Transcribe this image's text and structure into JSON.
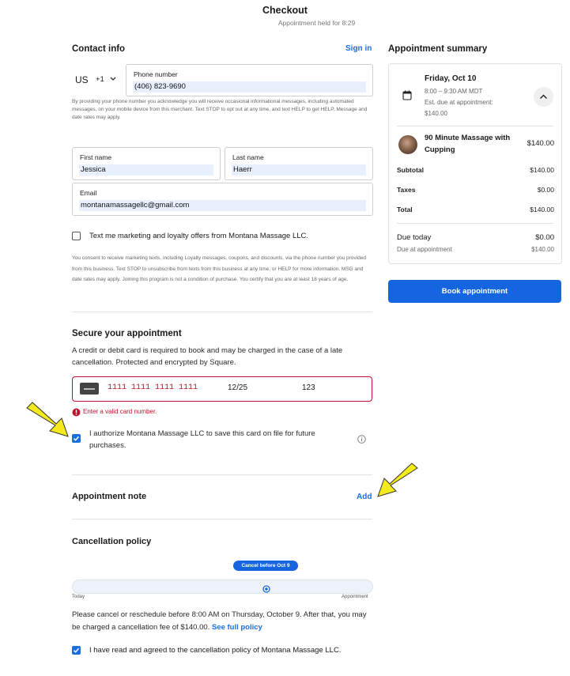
{
  "header": {
    "title": "Checkout",
    "subtitle": "Appointment held for 8:29"
  },
  "contact": {
    "heading": "Contact info",
    "sign_in": "Sign in",
    "country": "US",
    "dial_code": "+1",
    "phone_label": "Phone number",
    "phone_value": "(406) 823-9690",
    "phone_disclaimer": "By providing your phone number you acknowledge you will receive occasional informational messages, including automated messages, on your mobile device from this merchant. Text STOP to opt out at any time, and text HELP to get HELP. Message and date rates may apply.",
    "first_name_label": "First name",
    "first_name_value": "Jessica",
    "last_name_label": "Last name",
    "last_name_value": "Haerr",
    "email_label": "Email",
    "email_value": "montanamassagellc@gmail.com",
    "marketing_label": "Text me marketing and loyalty offers from Montana Massage LLC.",
    "marketing_disclaimer": "You consent to receive marketing texts, including Loyalty messages, coupons, and discounts, via the phone number you provided from this business. Text STOP to unsubscribe from texts from this business at any time, or HELP for more information. MSG and date rates may apply. Joining this program is not a condition of purchase. You certify that you are at least 18 years of age."
  },
  "secure": {
    "heading": "Secure your appointment",
    "description": "A credit or debit card is required to book and may be charged in the case of a late cancellation. Protected and encrypted by Square.",
    "card_number": "1111 1111 1111 1111",
    "expiry": "12/25",
    "cvv": "123",
    "error": "Enter a valid card number.",
    "authorize_label": "I authorize Montana Massage LLC to save this card on file for future purchases."
  },
  "note": {
    "heading": "Appointment note",
    "add": "Add"
  },
  "cancellation": {
    "heading": "Cancellation policy",
    "pill": "Cancel before Oct 9",
    "today_label": "Today",
    "appointment_label": "Appointment",
    "text": "Please cancel or reschedule before 8:00 AM on Thursday, October 9. After that, you may be charged a cancellation fee of $140.00.",
    "full_policy_link": "See full policy",
    "agree_label": "I have read and agreed to the cancellation policy of Montana Massage LLC."
  },
  "summary": {
    "heading": "Appointment summary",
    "date": "Friday, Oct 10",
    "time": "8:00 – 9:30 AM MDT",
    "est_due": "Est. due at appointment:",
    "est_amount": "$140.00",
    "service_name_line1": "90 Minute Massage with",
    "service_name_line2": "Cupping",
    "service_price": "$140.00",
    "subtotal_label": "Subtotal",
    "subtotal": "$140.00",
    "taxes_label": "Taxes",
    "taxes": "$0.00",
    "total_label": "Total",
    "total": "$140.00",
    "due_today_label": "Due today",
    "due_today": "$0.00",
    "due_appt_label": "Due at appointment",
    "due_appt": "$140.00",
    "book_button": "Book appointment"
  },
  "icons": [
    "calendar-icon",
    "chevron-down-icon",
    "chevron-up-icon",
    "card-icon",
    "error-icon",
    "info-icon",
    "check-icon",
    "arrow-annotation"
  ],
  "colors": {
    "accent": "#1565e0",
    "error": "#c0122e",
    "annotation": "#f5ea1c"
  }
}
